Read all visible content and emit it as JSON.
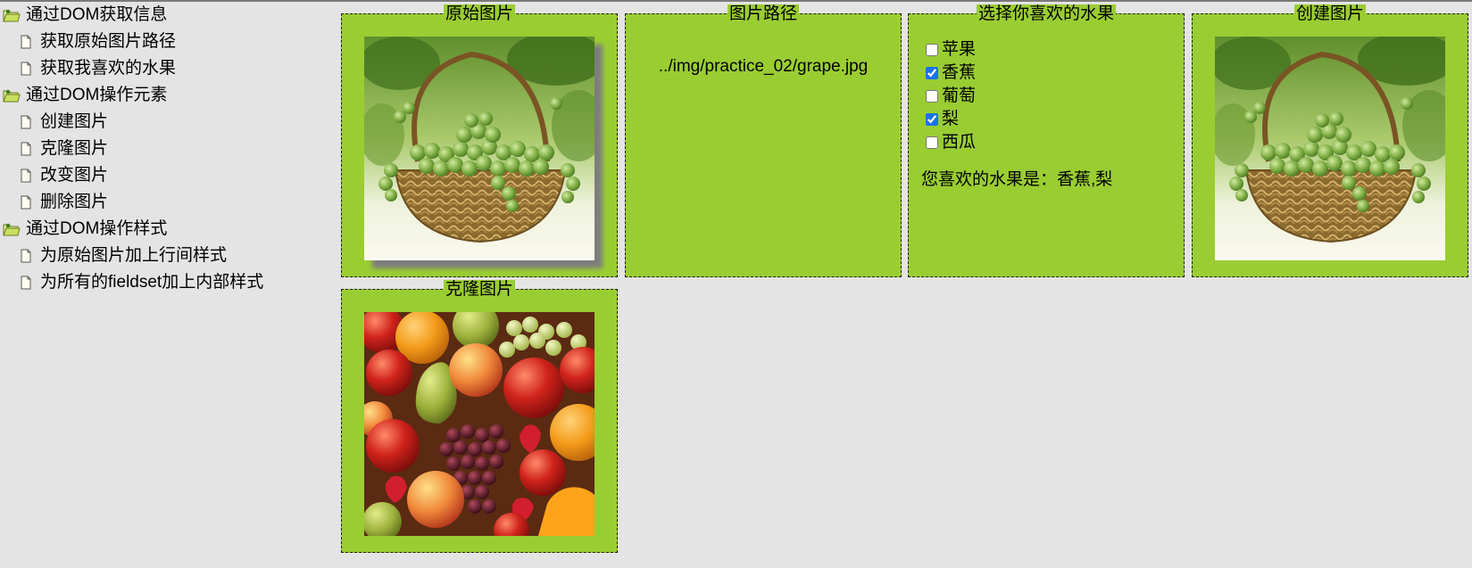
{
  "tree": {
    "groups": [
      {
        "label": "通过DOM获取信息",
        "children": [
          "获取原始图片路径",
          "获取我喜欢的水果"
        ]
      },
      {
        "label": "通过DOM操作元素",
        "children": [
          "创建图片",
          "克隆图片",
          "改变图片",
          "删除图片"
        ]
      },
      {
        "label": "通过DOM操作样式",
        "children": [
          "为原始图片加上行间样式",
          "为所有的fieldset加上内部样式"
        ]
      }
    ]
  },
  "panels": {
    "original": {
      "legend": "原始图片"
    },
    "path": {
      "legend": "图片路径",
      "value": "../img/practice_02/grape.jpg"
    },
    "fruits": {
      "legend": "选择你喜欢的水果",
      "options": [
        {
          "label": "苹果",
          "checked": false
        },
        {
          "label": "香蕉",
          "checked": true
        },
        {
          "label": "葡萄",
          "checked": false
        },
        {
          "label": "梨",
          "checked": true
        },
        {
          "label": "西瓜",
          "checked": false
        }
      ],
      "result_label": "您喜欢的水果是：",
      "result_value": "香蕉,梨"
    },
    "created": {
      "legend": "创建图片"
    },
    "cloned": {
      "legend": "克隆图片"
    }
  },
  "colors": {
    "page_bg": "#e4e4e4",
    "panel_bg": "#9acd32",
    "checkbox_accent": "#1a73e8"
  },
  "icons": {
    "group": "folder-icon",
    "child": "document-icon"
  }
}
